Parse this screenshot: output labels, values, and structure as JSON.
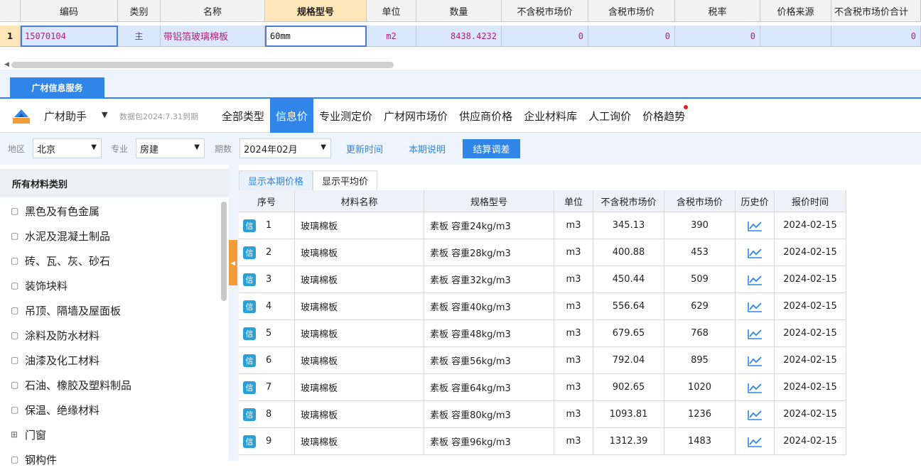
{
  "top_grid": {
    "headers": [
      "编码",
      "类别",
      "名称",
      "规格型号",
      "单位",
      "数量",
      "不含税市场价",
      "含税市场价",
      "税率",
      "价格来源",
      "不含税市场价合计"
    ],
    "row": {
      "row_number": "1",
      "code": "15070104",
      "category": "主",
      "name": "带铝箔玻璃棉板",
      "spec": "60mm",
      "unit": "m2",
      "quantity": "8438.4232",
      "price_excl_tax": "0",
      "price_incl_tax": "0",
      "tax_rate": "0",
      "price_source": "",
      "total_excl_tax": "0"
    }
  },
  "service_tab": "广材信息服务",
  "toolbar": {
    "assistant_label": "广材助手",
    "assistant_caret": "▼",
    "package_info": "数据包2024.7.31到期",
    "nav_tabs": [
      "全部类型",
      "信息价",
      "专业测定价",
      "广材网市场价",
      "供应商价格",
      "企业材料库",
      "人工询价",
      "价格趋势"
    ],
    "active_tab": "信息价"
  },
  "filters": {
    "region_label": "地区",
    "region_value": "北京",
    "specialty_label": "专业",
    "specialty_value": "房建",
    "period_label": "期数",
    "period_value": "2024年02月",
    "update_time_button": "更新时间",
    "period_note_button": "本期说明",
    "settle_adjust_button": "结算调差"
  },
  "categories": {
    "title": "所有材料类别",
    "items": [
      {
        "label": "黑色及有色金属",
        "expandable": false
      },
      {
        "label": "水泥及混凝土制品",
        "expandable": false
      },
      {
        "label": "砖、瓦、灰、砂石",
        "expandable": false
      },
      {
        "label": "装饰块料",
        "expandable": false
      },
      {
        "label": "吊顶、隔墙及屋面板",
        "expandable": false
      },
      {
        "label": "涂料及防水材料",
        "expandable": false
      },
      {
        "label": "油漆及化工材料",
        "expandable": false
      },
      {
        "label": "石油、橡胶及塑料制品",
        "expandable": false
      },
      {
        "label": "保温、绝缘材料",
        "expandable": false
      },
      {
        "label": "门窗",
        "expandable": true
      },
      {
        "label": "钢构件",
        "expandable": false
      }
    ]
  },
  "price_table": {
    "subtabs": [
      "显示本期价格",
      "显示平均价"
    ],
    "active_subtab": "显示本期价格",
    "headers": [
      "序号",
      "材料名称",
      "规格型号",
      "单位",
      "不含税市场价",
      "含税市场价",
      "历史价",
      "报价时间"
    ],
    "source_badge": "信",
    "rows": [
      {
        "seq": "1",
        "name": "玻璃棉板",
        "spec": "素板 容重24kg/m3",
        "unit": "m3",
        "price_excl_tax": "345.13",
        "price_incl_tax": "390",
        "date": "2024-02-15"
      },
      {
        "seq": "2",
        "name": "玻璃棉板",
        "spec": "素板 容重28kg/m3",
        "unit": "m3",
        "price_excl_tax": "400.88",
        "price_incl_tax": "453",
        "date": "2024-02-15"
      },
      {
        "seq": "3",
        "name": "玻璃棉板",
        "spec": "素板 容重32kg/m3",
        "unit": "m3",
        "price_excl_tax": "450.44",
        "price_incl_tax": "509",
        "date": "2024-02-15"
      },
      {
        "seq": "4",
        "name": "玻璃棉板",
        "spec": "素板 容重40kg/m3",
        "unit": "m3",
        "price_excl_tax": "556.64",
        "price_incl_tax": "629",
        "date": "2024-02-15"
      },
      {
        "seq": "5",
        "name": "玻璃棉板",
        "spec": "素板 容重48kg/m3",
        "unit": "m3",
        "price_excl_tax": "679.65",
        "price_incl_tax": "768",
        "date": "2024-02-15"
      },
      {
        "seq": "6",
        "name": "玻璃棉板",
        "spec": "素板 容重56kg/m3",
        "unit": "m3",
        "price_excl_tax": "792.04",
        "price_incl_tax": "895",
        "date": "2024-02-15"
      },
      {
        "seq": "7",
        "name": "玻璃棉板",
        "spec": "素板 容重64kg/m3",
        "unit": "m3",
        "price_excl_tax": "902.65",
        "price_incl_tax": "1020",
        "date": "2024-02-15"
      },
      {
        "seq": "8",
        "name": "玻璃棉板",
        "spec": "素板 容重80kg/m3",
        "unit": "m3",
        "price_excl_tax": "1093.81",
        "price_incl_tax": "1236",
        "date": "2024-02-15"
      },
      {
        "seq": "9",
        "name": "玻璃棉板",
        "spec": "素板 容重96kg/m3",
        "unit": "m3",
        "price_excl_tax": "1312.39",
        "price_incl_tax": "1483",
        "date": "2024-02-15"
      }
    ]
  },
  "colors": {
    "accent": "#2f86e8",
    "highlight": "#fde6b8",
    "selected_row": "#dbe7fb",
    "notice_dot": "#e02020",
    "collapse_handle": "#f39c3c"
  }
}
